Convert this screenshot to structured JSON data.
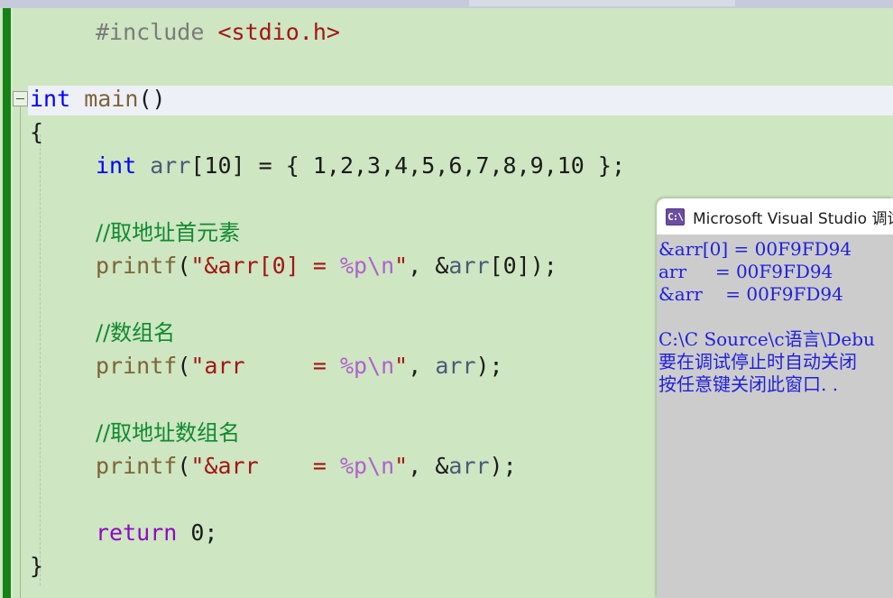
{
  "window": {
    "top_scrollbar": "horizontal-scrollbar"
  },
  "editor": {
    "language": "c",
    "background_color": "#cee6c1",
    "change_bar_color": "#168216",
    "current_line_color": "#eef0f8",
    "outline_marker": "−",
    "lines": [
      {
        "indent": 1,
        "segments": [
          {
            "text": "#include ",
            "cls": "tok-pre"
          },
          {
            "text": "<stdio.h>",
            "cls": "tok-inc"
          }
        ]
      },
      {
        "indent": 0,
        "segments": []
      },
      {
        "indent": 0,
        "segments": [
          {
            "text": "int",
            "cls": "tok-kw"
          },
          {
            "text": " ",
            "cls": "tok-plain"
          },
          {
            "text": "main",
            "cls": "tok-fn"
          },
          {
            "text": "()",
            "cls": "tok-plain"
          }
        ]
      },
      {
        "indent": 0,
        "segments": [
          {
            "text": "{",
            "cls": "tok-plain"
          }
        ]
      },
      {
        "indent": 1,
        "segments": [
          {
            "text": "int",
            "cls": "tok-kw"
          },
          {
            "text": " ",
            "cls": "tok-plain"
          },
          {
            "text": "arr",
            "cls": "tok-id"
          },
          {
            "text": "[10] = { 1,2,3,4,5,6,7,8,9,10 };",
            "cls": "tok-plain"
          }
        ]
      },
      {
        "indent": 0,
        "segments": []
      },
      {
        "indent": 1,
        "segments": [
          {
            "text": "//取地址首元素",
            "cls": "tok-cmt cmt-cn"
          }
        ]
      },
      {
        "indent": 1,
        "segments": [
          {
            "text": "printf",
            "cls": "tok-fn"
          },
          {
            "text": "(",
            "cls": "tok-plain"
          },
          {
            "text": "\"&arr[0] = ",
            "cls": "tok-str"
          },
          {
            "text": "%p",
            "cls": "tok-esc"
          },
          {
            "text": "\\n",
            "cls": "tok-esc"
          },
          {
            "text": "\"",
            "cls": "tok-str"
          },
          {
            "text": ", &",
            "cls": "tok-plain"
          },
          {
            "text": "arr",
            "cls": "tok-id"
          },
          {
            "text": "[0]);",
            "cls": "tok-plain"
          }
        ]
      },
      {
        "indent": 0,
        "segments": []
      },
      {
        "indent": 1,
        "segments": [
          {
            "text": "//数组名",
            "cls": "tok-cmt cmt-cn"
          }
        ]
      },
      {
        "indent": 1,
        "segments": [
          {
            "text": "printf",
            "cls": "tok-fn"
          },
          {
            "text": "(",
            "cls": "tok-plain"
          },
          {
            "text": "\"arr     = ",
            "cls": "tok-str"
          },
          {
            "text": "%p",
            "cls": "tok-esc"
          },
          {
            "text": "\\n",
            "cls": "tok-esc"
          },
          {
            "text": "\"",
            "cls": "tok-str"
          },
          {
            "text": ", ",
            "cls": "tok-plain"
          },
          {
            "text": "arr",
            "cls": "tok-id"
          },
          {
            "text": ");",
            "cls": "tok-plain"
          }
        ]
      },
      {
        "indent": 0,
        "segments": []
      },
      {
        "indent": 1,
        "segments": [
          {
            "text": "//取地址数组名",
            "cls": "tok-cmt cmt-cn"
          }
        ]
      },
      {
        "indent": 1,
        "segments": [
          {
            "text": "printf",
            "cls": "tok-fn"
          },
          {
            "text": "(",
            "cls": "tok-plain"
          },
          {
            "text": "\"&arr    = ",
            "cls": "tok-str"
          },
          {
            "text": "%p",
            "cls": "tok-esc"
          },
          {
            "text": "\\n",
            "cls": "tok-esc"
          },
          {
            "text": "\"",
            "cls": "tok-str"
          },
          {
            "text": ", &",
            "cls": "tok-plain"
          },
          {
            "text": "arr",
            "cls": "tok-id"
          },
          {
            "text": ");",
            "cls": "tok-plain"
          }
        ]
      },
      {
        "indent": 0,
        "segments": []
      },
      {
        "indent": 1,
        "segments": [
          {
            "text": "return",
            "cls": "tok-ret"
          },
          {
            "text": " 0;",
            "cls": "tok-plain"
          }
        ]
      },
      {
        "indent": 0,
        "segments": [
          {
            "text": "}",
            "cls": "tok-plain"
          }
        ]
      }
    ]
  },
  "console": {
    "icon": "console-icon",
    "icon_glyph": "C:\\",
    "title": "Microsoft Visual Studio 调试",
    "text_color": "#2020dd",
    "background_color": "#cccccc",
    "lines": [
      "&arr[0] = 00F9FD94",
      "arr     = 00F9FD94",
      "&arr    = 00F9FD94",
      "",
      "C:\\C Source\\c语言\\Debu",
      "要在调试停止时自动关闭",
      "按任意键关闭此窗口. ."
    ]
  }
}
